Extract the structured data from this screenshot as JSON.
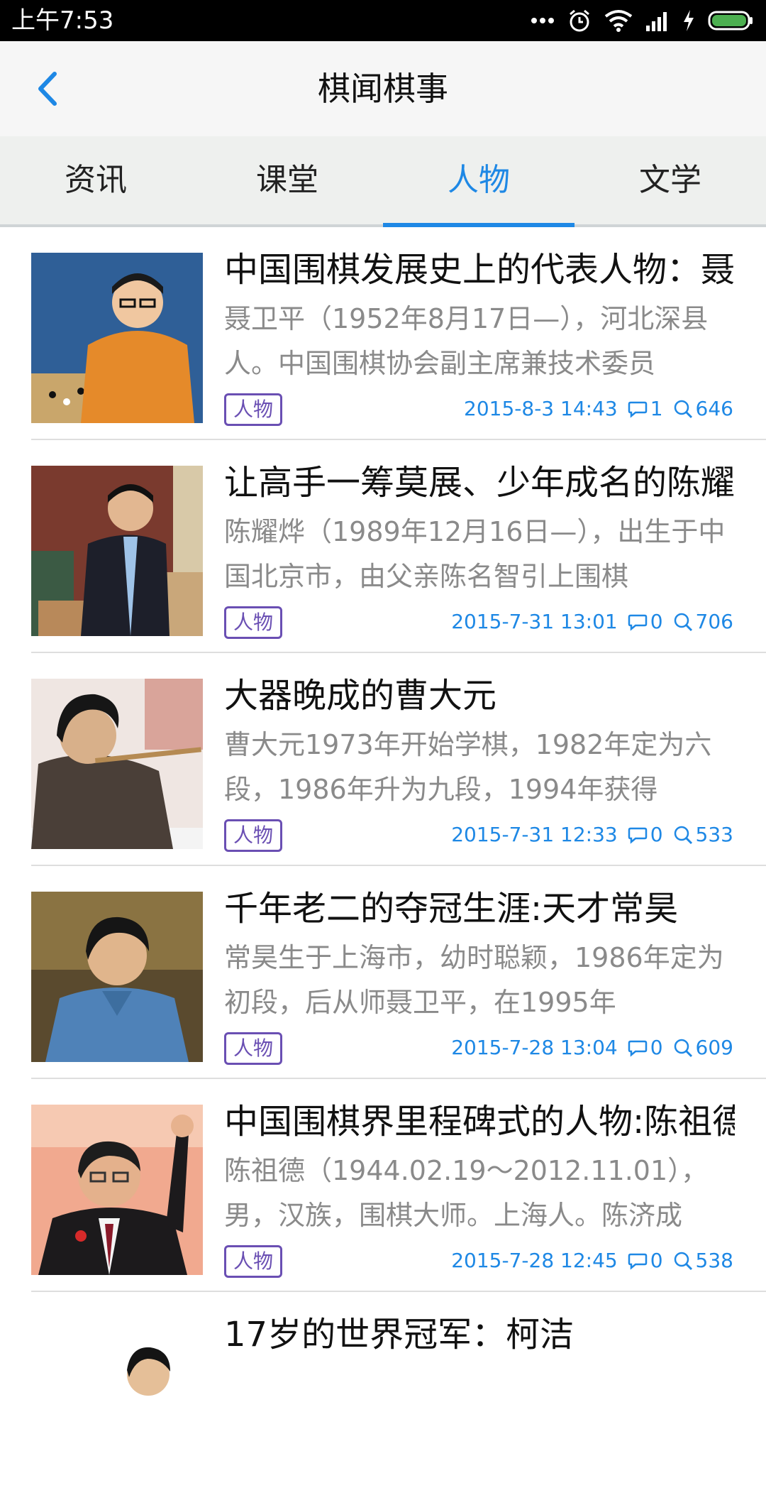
{
  "status_bar": {
    "time": "上午7:53",
    "icons": [
      "more-dots-icon",
      "alarm-icon",
      "wifi-icon",
      "signal-icon",
      "charging-icon",
      "battery-icon"
    ]
  },
  "header": {
    "title": "棋闻棋事",
    "back_icon": "chevron-left-icon"
  },
  "tabs": [
    {
      "label": "资讯",
      "active": false
    },
    {
      "label": "课堂",
      "active": false
    },
    {
      "label": "人物",
      "active": true
    },
    {
      "label": "文学",
      "active": false
    }
  ],
  "articles": [
    {
      "title": "中国围棋发展史上的代表人物：聂卫平",
      "desc": "聂卫平（1952年8月17日—），河北深县人。中国围棋协会副主席兼技术委员",
      "tag": "人物",
      "date": "2015-8-3 14:43",
      "comments": "1",
      "views": "646"
    },
    {
      "title": "让高手一筹莫展、少年成名的陈耀烨",
      "desc": "陈耀烨（1989年12月16日—），出生于中国北京市，由父亲陈名智引上围棋",
      "tag": "人物",
      "date": "2015-7-31 13:01",
      "comments": "0",
      "views": "706"
    },
    {
      "title": "大器晚成的曹大元",
      "desc": "曹大元1973年开始学棋，1982年定为六段，1986年升为九段，1994年获得",
      "tag": "人物",
      "date": "2015-7-31 12:33",
      "comments": "0",
      "views": "533"
    },
    {
      "title": "千年老二的夺冠生涯:天才常昊",
      "desc": "常昊生于上海市，幼时聪颖，1986年定为初段，后从师聂卫平，在1995年",
      "tag": "人物",
      "date": "2015-7-28 13:04",
      "comments": "0",
      "views": "609"
    },
    {
      "title": "中国围棋界里程碑式的人物:陈祖德",
      "desc": "陈祖德（1944.02.19～2012.11.01），男，汉族，围棋大师。上海人。陈济成",
      "tag": "人物",
      "date": "2015-7-28 12:45",
      "comments": "0",
      "views": "538"
    },
    {
      "title": "17岁的世界冠军：柯洁",
      "desc": "",
      "tag": "",
      "date": "",
      "comments": "",
      "views": ""
    }
  ],
  "colors": {
    "accent": "#1e88e5",
    "tag": "#6a4fb3",
    "desc_text": "#8a8a8a"
  }
}
